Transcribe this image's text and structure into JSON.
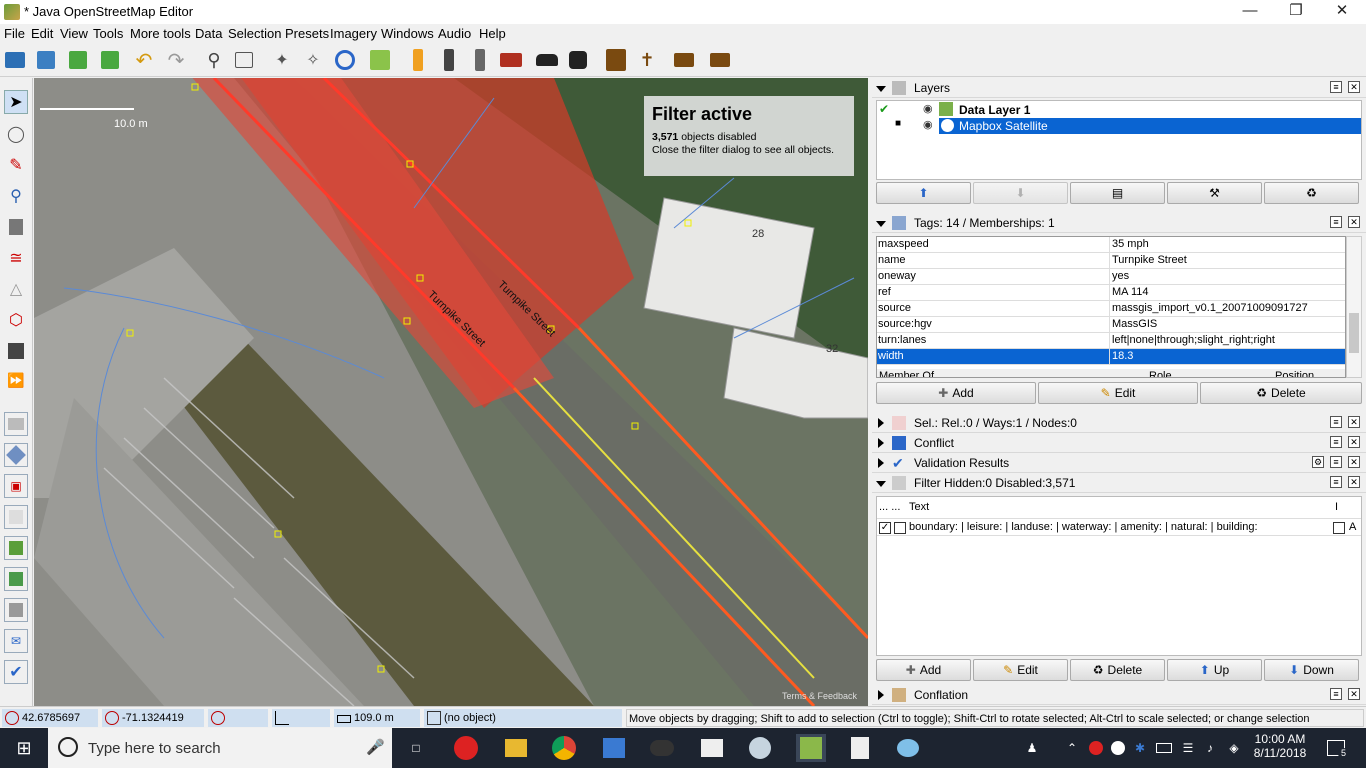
{
  "window": {
    "title": "* Java OpenStreetMap Editor"
  },
  "menu": [
    "File",
    "Edit",
    "View",
    "Tools",
    "More tools",
    "Data",
    "Selection",
    "Presets",
    "Imagery",
    "Windows",
    "Audio",
    "Help"
  ],
  "map": {
    "scale_label": "10.0 m",
    "filter": {
      "title": "Filter active",
      "count": "3,571",
      "count_suffix": " objects disabled",
      "hint": "Close the filter dialog to see all objects."
    },
    "street_labels": [
      "Turnpike Street",
      "Turnpike Street"
    ],
    "building_labels": [
      "28",
      "32"
    ],
    "attribution": "Terms & Feedback"
  },
  "layers": {
    "title": "Layers",
    "items": [
      {
        "name": "Data Layer 1",
        "bold": true
      },
      {
        "name": "Mapbox Satellite",
        "bold": false
      }
    ]
  },
  "tags": {
    "title": "Tags: 14 / Memberships: 1",
    "rows": [
      {
        "k": "maxspeed",
        "v": "35 mph"
      },
      {
        "k": "name",
        "v": "Turnpike Street"
      },
      {
        "k": "oneway",
        "v": "yes"
      },
      {
        "k": "ref",
        "v": "MA 114"
      },
      {
        "k": "source",
        "v": "massgis_import_v0.1_20071009091727"
      },
      {
        "k": "source:hgv",
        "v": "MassGIS"
      },
      {
        "k": "turn:lanes",
        "v": "left|none|through;slight_right;right"
      },
      {
        "k": "width",
        "v": "18.3"
      }
    ],
    "member_headers": [
      "Member Of",
      "Role",
      "Position"
    ],
    "buttons": {
      "add": "Add",
      "edit": "Edit",
      "delete": "Delete"
    }
  },
  "panels": {
    "selection": "Sel.: Rel.:0 / Ways:1 / Nodes:0",
    "conflict": "Conflict",
    "validation": "Validation Results",
    "filter": "Filter Hidden:0 Disabled:3,571",
    "conflation": "Conflation"
  },
  "filter_table": {
    "header_dots": "... ...",
    "header_text": "Text",
    "header_i": "I",
    "row_text": "boundary: | leisure: | landuse: | waterway: | amenity: | natural: | building:",
    "row_flag": "A",
    "buttons": {
      "add": "Add",
      "edit": "Edit",
      "delete": "Delete",
      "up": "Up",
      "down": "Down"
    }
  },
  "status": {
    "lat": "42.6785697",
    "lon": "-71.1324419",
    "dist": "109.0 m",
    "obj": "(no object)",
    "help": "Move objects by dragging; Shift to add to selection (Ctrl to toggle); Shift-Ctrl to rotate selected; Alt-Ctrl to scale selected; or change selection"
  },
  "taskbar": {
    "search_placeholder": "Type here to search",
    "time": "10:00 AM",
    "date": "8/11/2018",
    "notif_count": "5"
  }
}
